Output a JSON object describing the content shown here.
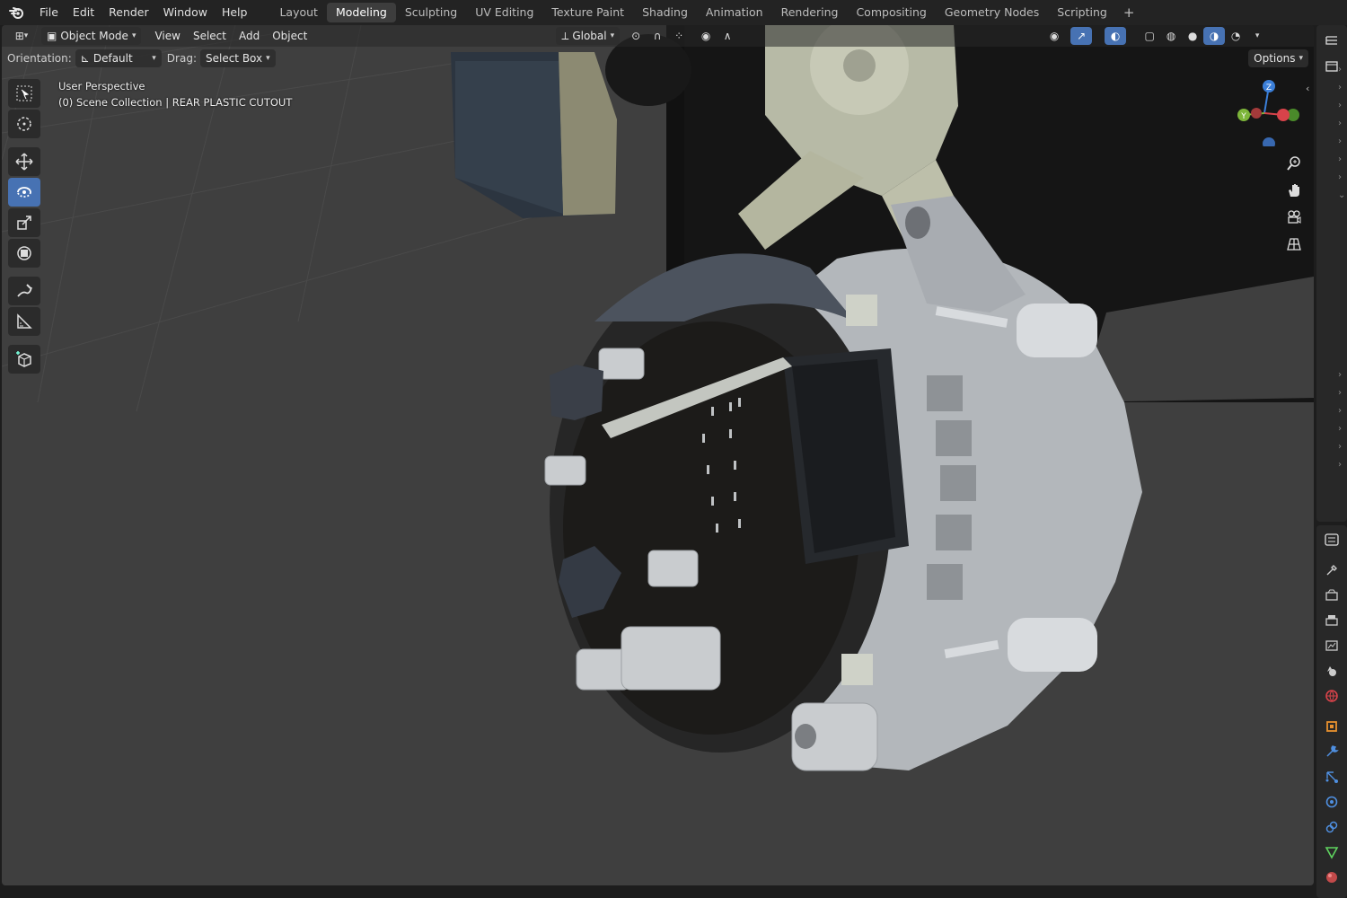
{
  "menu": [
    "File",
    "Edit",
    "Render",
    "Window",
    "Help"
  ],
  "workspaces": [
    "Layout",
    "Modeling",
    "Sculpting",
    "UV Editing",
    "Texture Paint",
    "Shading",
    "Animation",
    "Rendering",
    "Compositing",
    "Geometry Nodes",
    "Scripting"
  ],
  "active_workspace": "Modeling",
  "viewport_header": {
    "mode": "Object Mode",
    "menus": [
      "View",
      "Select",
      "Add",
      "Object"
    ],
    "transform_orientation": "Global"
  },
  "tool_header": {
    "orientation_label": "Orientation:",
    "orientation_value": "Default",
    "drag_label": "Drag:",
    "drag_value": "Select Box",
    "options": "Options"
  },
  "overlay": {
    "perspective": "User Perspective",
    "collection": "(0) Scene Collection | REAR PLASTIC CUTOUT"
  },
  "gizmo": {
    "z": "Z",
    "y": "Y"
  },
  "colors": {
    "accent": "#4772b3",
    "viewport_bg": "#3f3f3f",
    "axis_x": "#d8434a",
    "axis_y": "#7db53a",
    "axis_z": "#3b7fd9"
  },
  "toolbar_icons": [
    "select-box-icon",
    "cursor-icon",
    "move-icon",
    "rotate-icon",
    "scale-icon",
    "transform-icon",
    "annotate-icon",
    "measure-icon",
    "add-cube-icon"
  ],
  "active_tool": "rotate-icon"
}
